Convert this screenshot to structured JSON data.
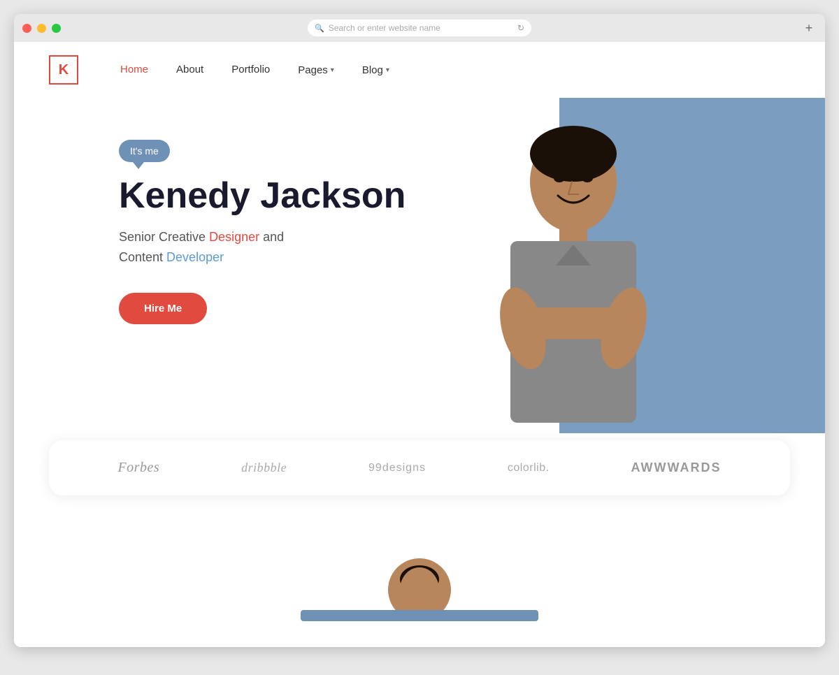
{
  "browser": {
    "address_placeholder": "Search or enter website name",
    "new_tab_label": "+"
  },
  "nav": {
    "logo_letter": "K",
    "links": [
      {
        "id": "home",
        "label": "Home",
        "active": true,
        "has_arrow": false
      },
      {
        "id": "about",
        "label": "About",
        "active": false,
        "has_arrow": false
      },
      {
        "id": "portfolio",
        "label": "Portfolio",
        "active": false,
        "has_arrow": false
      },
      {
        "id": "pages",
        "label": "Pages",
        "active": false,
        "has_arrow": true
      },
      {
        "id": "blog",
        "label": "Blog",
        "active": false,
        "has_arrow": true
      }
    ]
  },
  "hero": {
    "bubble_text": "It's me",
    "name": "Kenedy Jackson",
    "subtitle_part1": "Senior Creative ",
    "designer_text": "Designer",
    "subtitle_part2": " and",
    "subtitle_line2_part1": "Content ",
    "developer_text": "Developer",
    "cta_button": "Hire Me"
  },
  "brands": {
    "logos": [
      {
        "id": "forbes",
        "label": "Forbes",
        "class": "brand-forbes"
      },
      {
        "id": "dribbble",
        "label": "dribbble",
        "class": "brand-dribbble"
      },
      {
        "id": "99designs",
        "label": "99designs",
        "class": "brand-99designs"
      },
      {
        "id": "colorlib",
        "label": "colorlib.",
        "class": "brand-colorlib"
      },
      {
        "id": "awwwards",
        "label": "AWWWARDS",
        "class": "brand-awwwards"
      }
    ]
  },
  "colors": {
    "red": "#e04a3f",
    "blue_bg": "#7b9dc0",
    "blue_mid": "#6e91b5",
    "text_dark": "#1a1a2e",
    "designer_color": "#e04a3f",
    "developer_color": "#5b9bd5"
  }
}
